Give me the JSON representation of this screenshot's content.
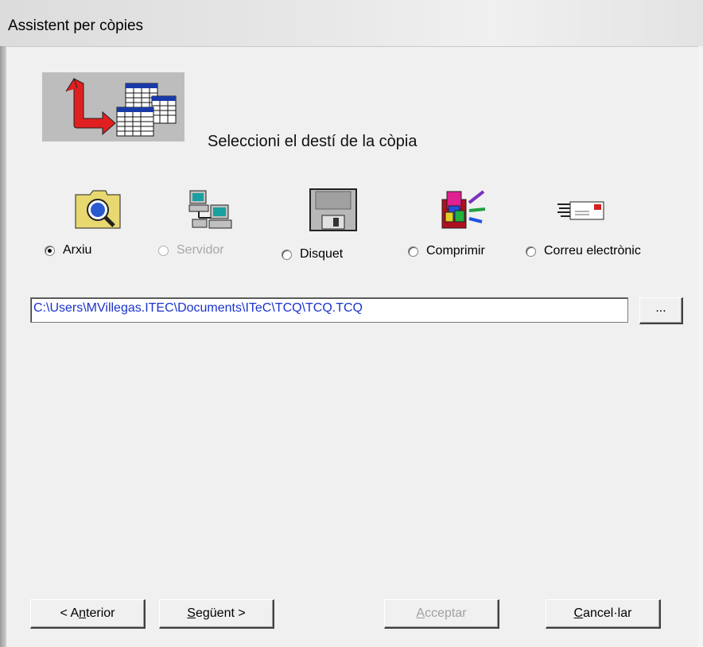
{
  "window": {
    "title": "Assistent per còpies"
  },
  "header": {
    "heading": "Seleccioni el destí de la còpia"
  },
  "destinations": [
    {
      "label": "Arxiu",
      "icon": "folder-search-icon",
      "checked": true,
      "enabled": true
    },
    {
      "label": "Servidor",
      "icon": "network-computers-icon",
      "checked": false,
      "enabled": false
    },
    {
      "label": "Disquet",
      "icon": "floppy-disk-icon",
      "checked": false,
      "enabled": true
    },
    {
      "label": "Comprimir",
      "icon": "compress-boxes-icon",
      "checked": false,
      "enabled": true
    },
    {
      "label": "Correu electrònic",
      "icon": "email-envelope-icon",
      "checked": false,
      "enabled": true
    }
  ],
  "path": {
    "value": "C:\\Users\\MVillegas.ITEC\\Documents\\ITeC\\TCQ\\TCQ.TCQ"
  },
  "browse_button": {
    "label": "..."
  },
  "buttons": {
    "back": {
      "pre": "< A",
      "accel": "n",
      "post": "terior"
    },
    "next": {
      "pre": "",
      "accel": "S",
      "post": "egüent >"
    },
    "accept": {
      "pre": "",
      "accel": "A",
      "post": "cceptar"
    },
    "cancel": {
      "pre": "",
      "accel": "C",
      "post": "ancel·lar"
    }
  },
  "colors": {
    "path_text": "#1a33cc",
    "arrow_red": "#e02020",
    "folder_yellow": "#e8d870"
  }
}
